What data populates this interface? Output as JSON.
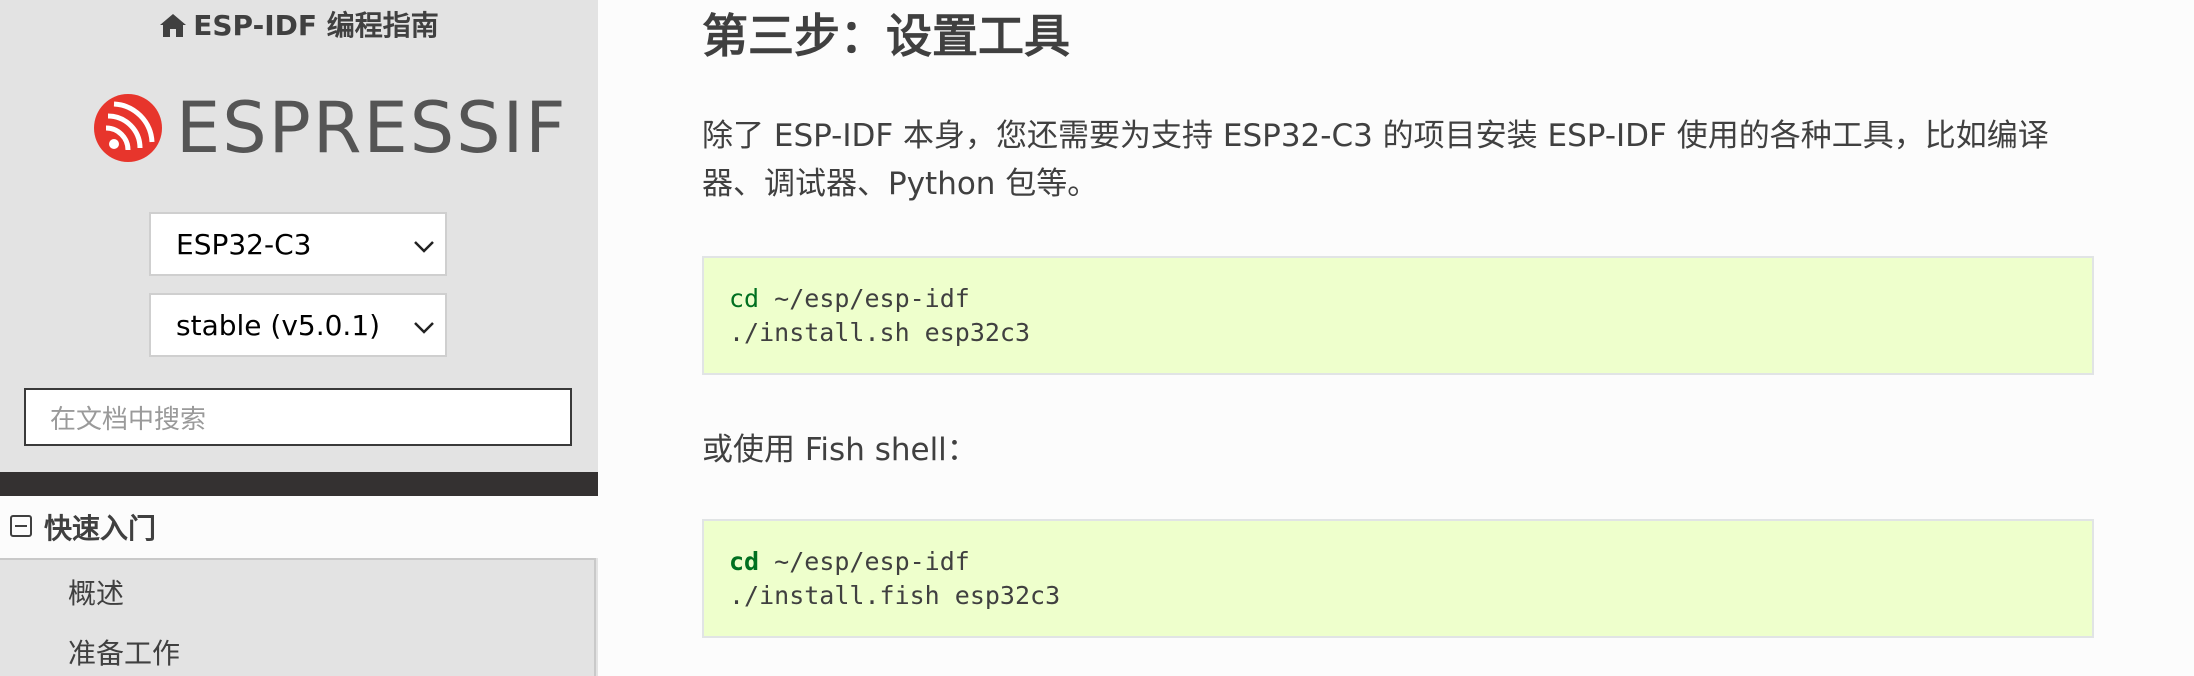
{
  "sidebar": {
    "project_title": "ESP-IDF 编程指南",
    "logo_text": "ESPRESSIF",
    "target_select": "ESP32-C3",
    "version_select": "stable (v5.0.1)",
    "search_placeholder": "在文档中搜索",
    "nav_current": "快速入门",
    "nav_items": [
      {
        "label": "概述"
      },
      {
        "label": "准备工作"
      }
    ]
  },
  "main": {
    "heading": "第三步：设置工具",
    "intro": "除了 ESP-IDF 本身，您还需要为支持 ESP32-C3 的项目安装 ESP-IDF 使用的各种工具，比如编译器、调试器、Python 包等。",
    "fish_intro": "或使用 Fish shell：",
    "code_bash": {
      "line1_cmd": "cd",
      "line1_rest": " ~/esp/esp-idf",
      "line2": "./install.sh esp32c3"
    },
    "code_fish": {
      "line1_cmd": "cd",
      "line1_rest": " ~/esp/esp-idf",
      "line2": "./install.fish esp32c3"
    }
  },
  "colors": {
    "sidebar_bg": "#e3e3e3",
    "code_bg": "#eeffcc",
    "keyword": "#007020",
    "logo_red": "#e7352c"
  }
}
